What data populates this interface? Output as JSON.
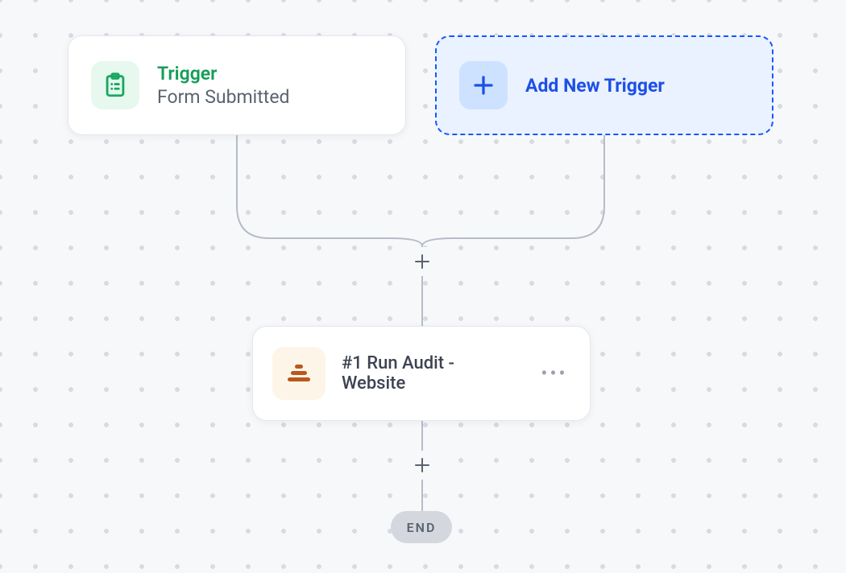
{
  "trigger": {
    "title": "Trigger",
    "subtitle": "Form Submitted"
  },
  "add_trigger": {
    "label": "Add New Trigger"
  },
  "step": {
    "label": "#1 Run Audit - Website"
  },
  "end": {
    "label": "END"
  },
  "icons": {
    "clipboard": "clipboard-icon",
    "plus": "plus-icon",
    "stack": "stack-icon",
    "more": "more-icon"
  },
  "colors": {
    "trigger_green": "#159d58",
    "add_blue": "#1e4fe6",
    "step_brown": "#b9571e",
    "end_gray": "#d5d7de"
  }
}
